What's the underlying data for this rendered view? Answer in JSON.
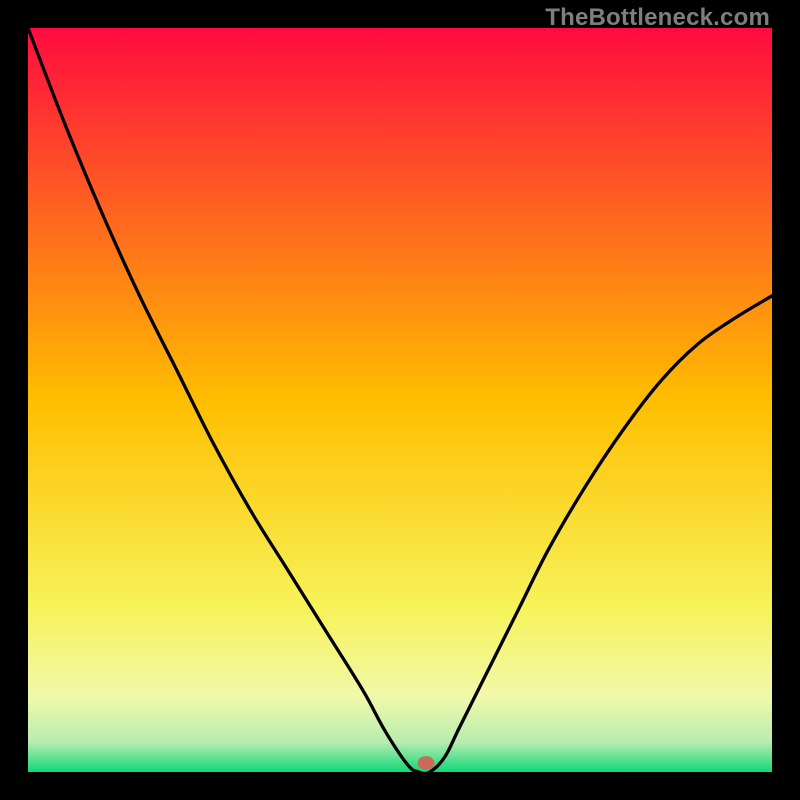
{
  "watermark": "TheBottleneck.com",
  "chart_data": {
    "type": "line",
    "title": "",
    "xlabel": "",
    "ylabel": "",
    "xlim": [
      0,
      1
    ],
    "ylim": [
      0,
      1
    ],
    "series": [
      {
        "name": "curve",
        "x": [
          0.0,
          0.05,
          0.1,
          0.15,
          0.2,
          0.25,
          0.3,
          0.35,
          0.4,
          0.45,
          0.48,
          0.51,
          0.525,
          0.54,
          0.56,
          0.58,
          0.62,
          0.66,
          0.7,
          0.75,
          0.8,
          0.85,
          0.9,
          0.95,
          1.0
        ],
        "y": [
          1.0,
          0.87,
          0.75,
          0.64,
          0.54,
          0.44,
          0.35,
          0.27,
          0.19,
          0.11,
          0.055,
          0.01,
          0.0,
          0.0,
          0.02,
          0.06,
          0.14,
          0.22,
          0.3,
          0.385,
          0.46,
          0.525,
          0.575,
          0.61,
          0.64
        ]
      }
    ],
    "marker": {
      "x": 0.535,
      "y": 0.012,
      "color": "#c76b5b"
    },
    "background_gradient": [
      {
        "offset": 0.0,
        "color": "#ff0b3f"
      },
      {
        "offset": 0.5,
        "color": "#ffbe00"
      },
      {
        "offset": 0.78,
        "color": "#f7f35a"
      },
      {
        "offset": 0.9,
        "color": "#f1f8ab"
      },
      {
        "offset": 0.96,
        "color": "#b7edb0"
      },
      {
        "offset": 1.0,
        "color": "#10d879"
      }
    ]
  }
}
